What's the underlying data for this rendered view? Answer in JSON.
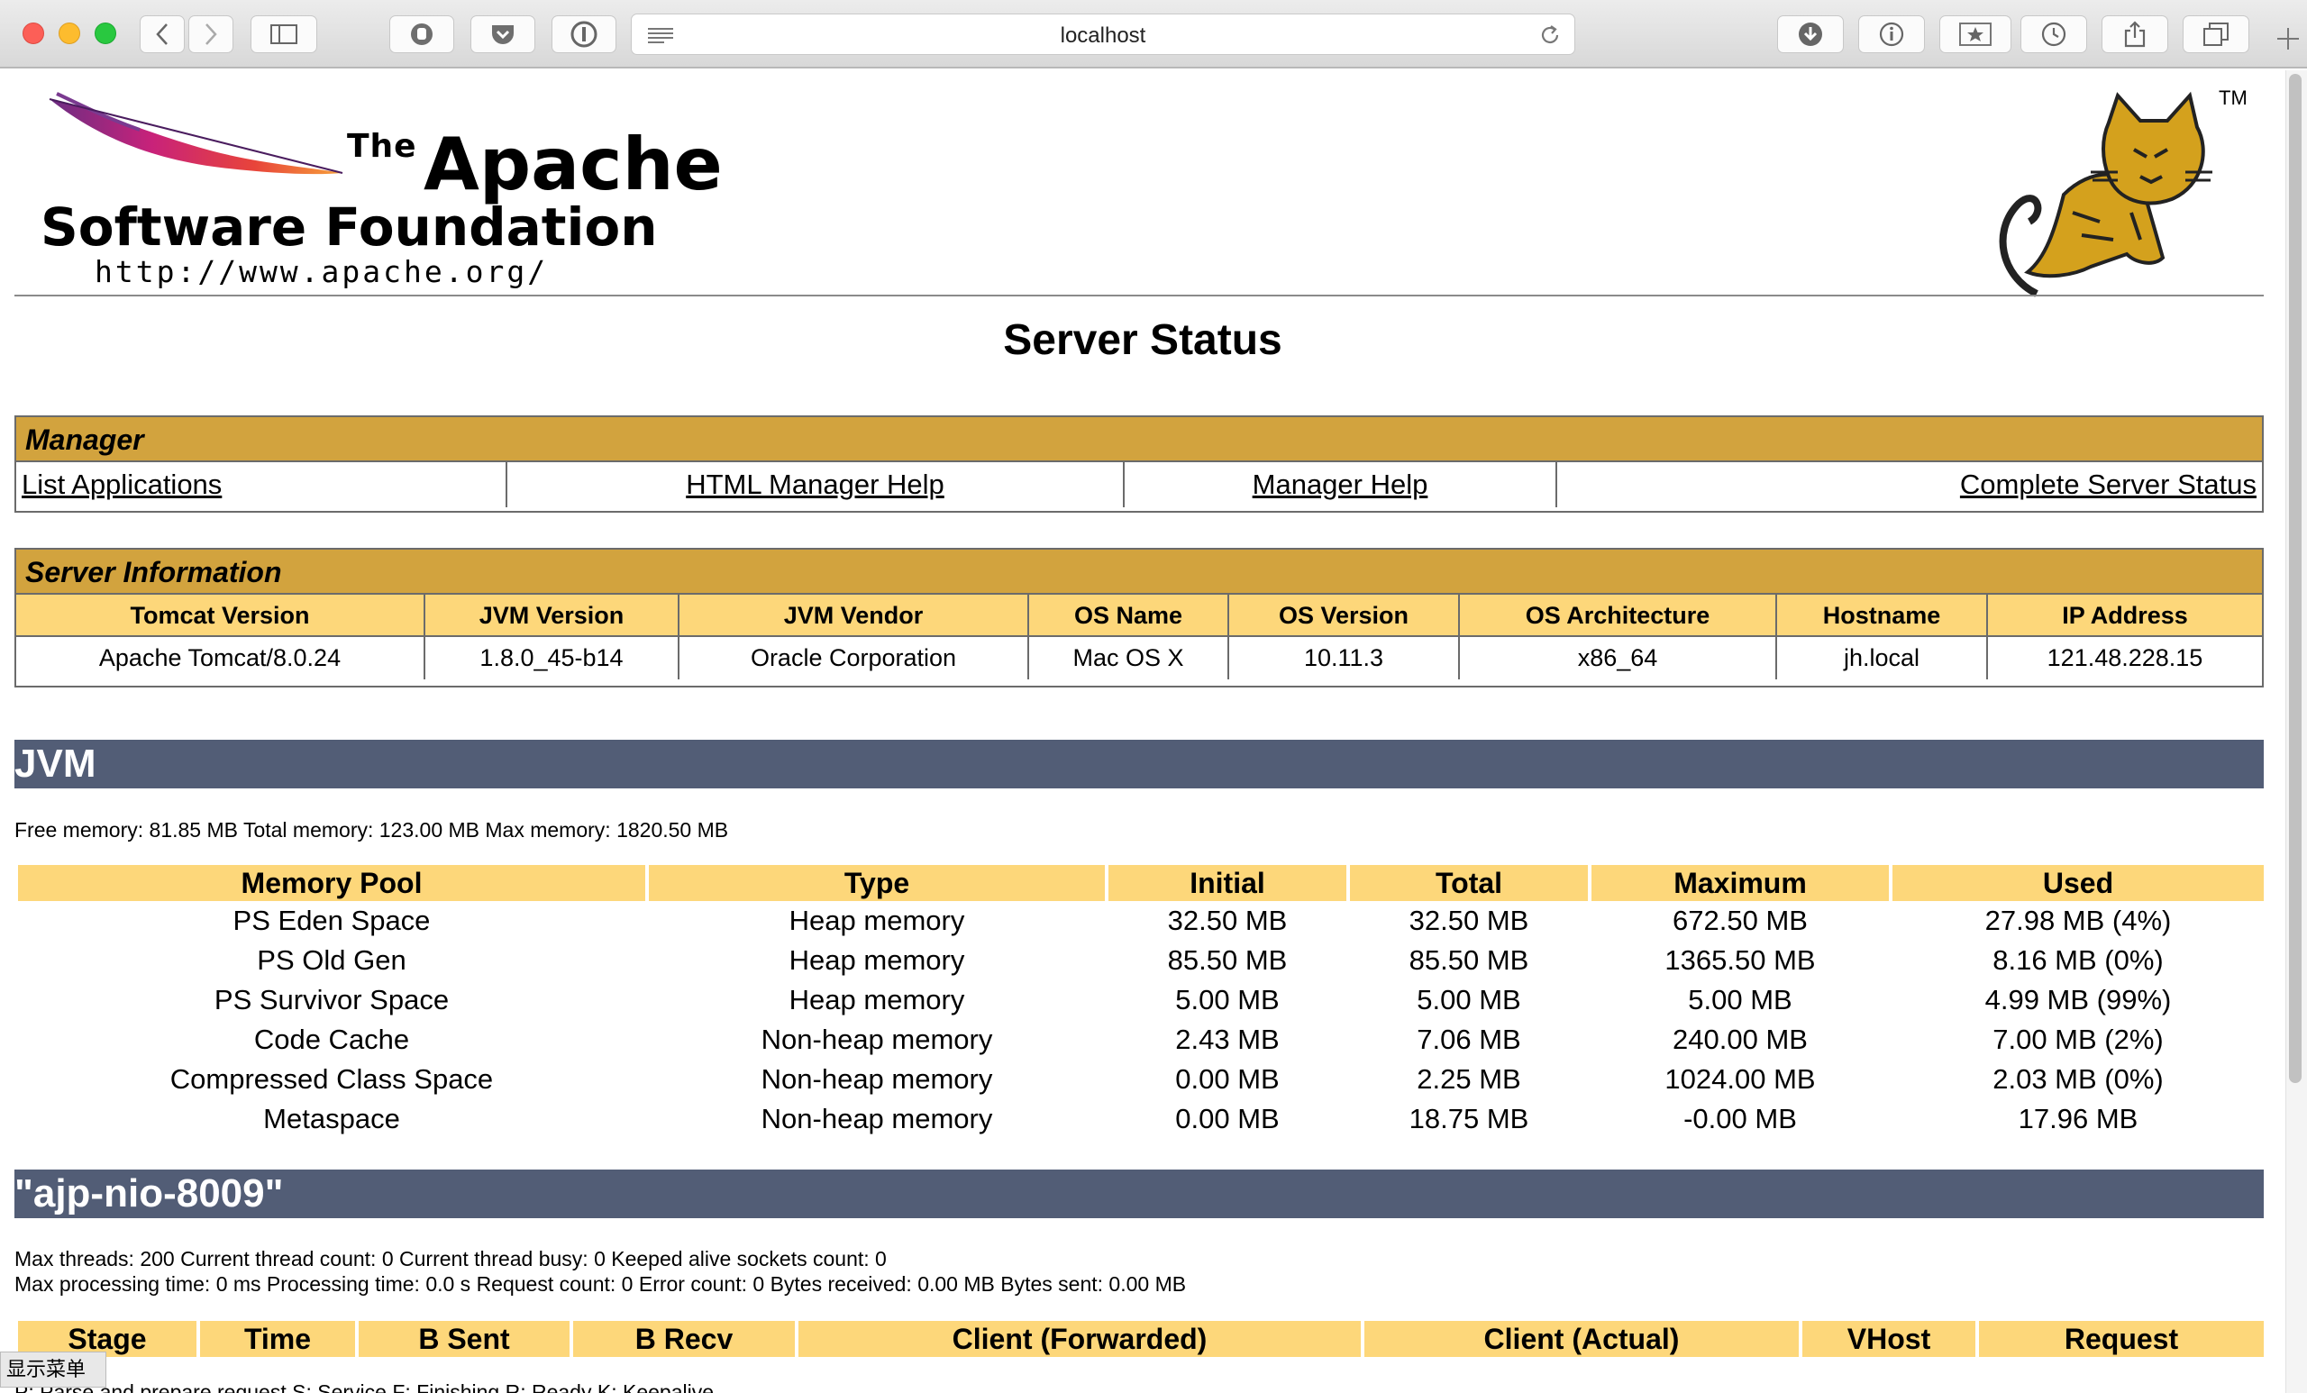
{
  "browser": {
    "url": "localhost"
  },
  "logo": {
    "the": "The",
    "apache": "Apache",
    "software_foundation": "Software Foundation",
    "url": "http://www.apache.org/",
    "tm": "TM"
  },
  "page": {
    "title": "Server Status"
  },
  "manager": {
    "title": "Manager",
    "links": [
      "List Applications",
      "HTML Manager Help",
      "Manager Help",
      "Complete Server Status"
    ]
  },
  "server_info": {
    "title": "Server Information",
    "headers": [
      "Tomcat Version",
      "JVM Version",
      "JVM Vendor",
      "OS Name",
      "OS Version",
      "OS Architecture",
      "Hostname",
      "IP Address"
    ],
    "values": [
      "Apache Tomcat/8.0.24",
      "1.8.0_45-b14",
      "Oracle Corporation",
      "Mac OS X",
      "10.11.3",
      "x86_64",
      "jh.local",
      "121.48.228.15"
    ]
  },
  "jvm": {
    "title": "JVM",
    "memory_line": "Free memory: 81.85 MB Total memory: 123.00 MB Max memory: 1820.50 MB",
    "headers": [
      "Memory Pool",
      "Type",
      "Initial",
      "Total",
      "Maximum",
      "Used"
    ],
    "rows": [
      [
        "PS Eden Space",
        "Heap memory",
        "32.50 MB",
        "32.50 MB",
        "672.50 MB",
        "27.98 MB (4%)"
      ],
      [
        "PS Old Gen",
        "Heap memory",
        "85.50 MB",
        "85.50 MB",
        "1365.50 MB",
        "8.16 MB (0%)"
      ],
      [
        "PS Survivor Space",
        "Heap memory",
        "5.00 MB",
        "5.00 MB",
        "5.00 MB",
        "4.99 MB (99%)"
      ],
      [
        "Code Cache",
        "Non-heap memory",
        "2.43 MB",
        "7.06 MB",
        "240.00 MB",
        "7.00 MB (2%)"
      ],
      [
        "Compressed Class Space",
        "Non-heap memory",
        "0.00 MB",
        "2.25 MB",
        "1024.00 MB",
        "2.03 MB (0%)"
      ],
      [
        "Metaspace",
        "Non-heap memory",
        "0.00 MB",
        "18.75 MB",
        "-0.00 MB",
        "17.96 MB"
      ]
    ]
  },
  "connector": {
    "title": "\"ajp-nio-8009\"",
    "line1": "Max threads: 200 Current thread count: 0 Current thread busy: 0 Keeped alive sockets count: 0",
    "line2": "Max processing time: 0 ms Processing time: 0.0 s Request count: 0 Error count: 0 Bytes received: 0.00 MB Bytes sent: 0.00 MB",
    "headers": [
      "Stage",
      "Time",
      "B Sent",
      "B Recv",
      "Client (Forwarded)",
      "Client (Actual)",
      "VHost",
      "Request"
    ],
    "legend_cutoff": "P: Parse and prepare request S: Service F: Finishing R: Ready K: Keepalive"
  },
  "ime": {
    "label": "显示菜单"
  }
}
